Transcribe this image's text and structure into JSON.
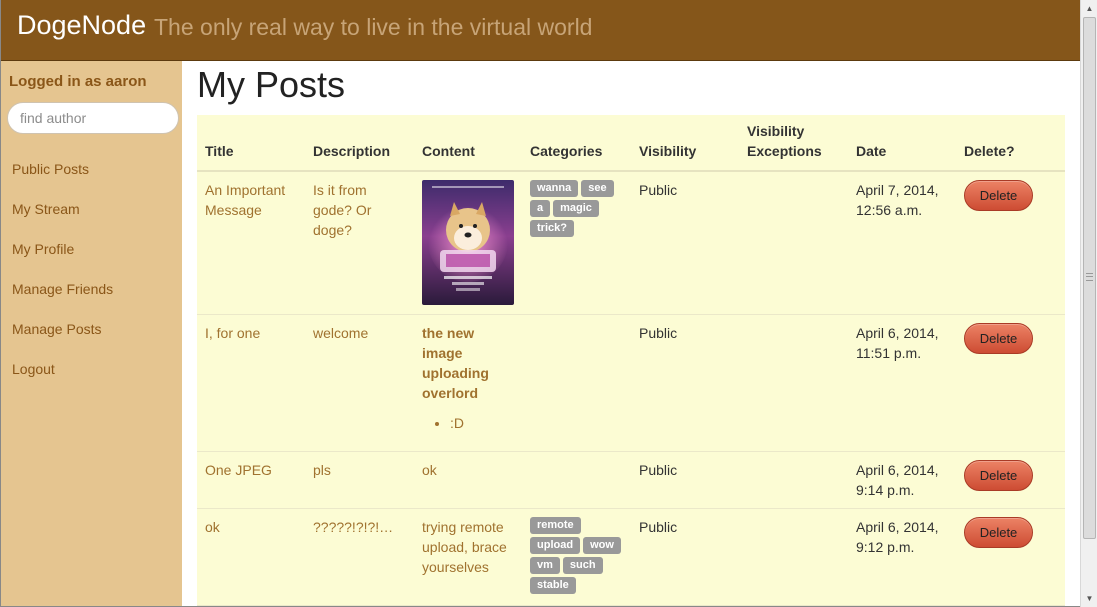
{
  "header": {
    "brand": "DogeNode",
    "tagline": "The only real way to live in the virtual world"
  },
  "sidebar": {
    "login_label": "Logged in as aaron",
    "search_placeholder": "find author",
    "items": [
      {
        "label": "Public Posts"
      },
      {
        "label": "My Stream"
      },
      {
        "label": "My Profile"
      },
      {
        "label": "Manage Friends"
      },
      {
        "label": "Manage Posts"
      },
      {
        "label": "Logout"
      }
    ]
  },
  "main": {
    "title": "My Posts",
    "columns": [
      "Title",
      "Description",
      "Content",
      "Categories",
      "Visibility",
      "Visibility Exceptions",
      "Date",
      "Delete?"
    ],
    "rows": [
      {
        "title": "An Important Message",
        "description": "Is it from gode? Or doge?",
        "content": "",
        "content_image": "doge-wow-poster-image",
        "categories": [
          "wanna",
          "see",
          "a",
          "magic",
          "trick?"
        ],
        "visibility": "Public",
        "exceptions": "",
        "date": "April 7, 2014, 12:56 a.m.",
        "delete_label": "Delete"
      },
      {
        "title": "I, for one",
        "description": "welcome",
        "content": "the new image uploading overlord",
        "content_list": [
          ":D"
        ],
        "categories": [],
        "visibility": "Public",
        "exceptions": "",
        "date": "April 6, 2014, 11:51 p.m.",
        "delete_label": "Delete"
      },
      {
        "title": "One JPEG",
        "description": "pls",
        "content": "ok",
        "categories": [],
        "visibility": "Public",
        "exceptions": "",
        "date": "April 6, 2014, 9:14 p.m.",
        "delete_label": "Delete"
      },
      {
        "title": "ok",
        "description": "?????!?!?!…",
        "content": "trying remote upload, brace yourselves",
        "categories": [
          "remote",
          "upload",
          "wow",
          "vm",
          "such",
          "stable"
        ],
        "visibility": "Public",
        "exceptions": "",
        "date": "April 6, 2014, 9:12 p.m.",
        "delete_label": "Delete"
      }
    ]
  },
  "colors": {
    "navbar": "#85561a",
    "sidebar": "#e5c590",
    "table_bg": "#fcfcd4",
    "link": "#a0722f",
    "delete_button": "#d9573c",
    "tag": "#999999"
  }
}
